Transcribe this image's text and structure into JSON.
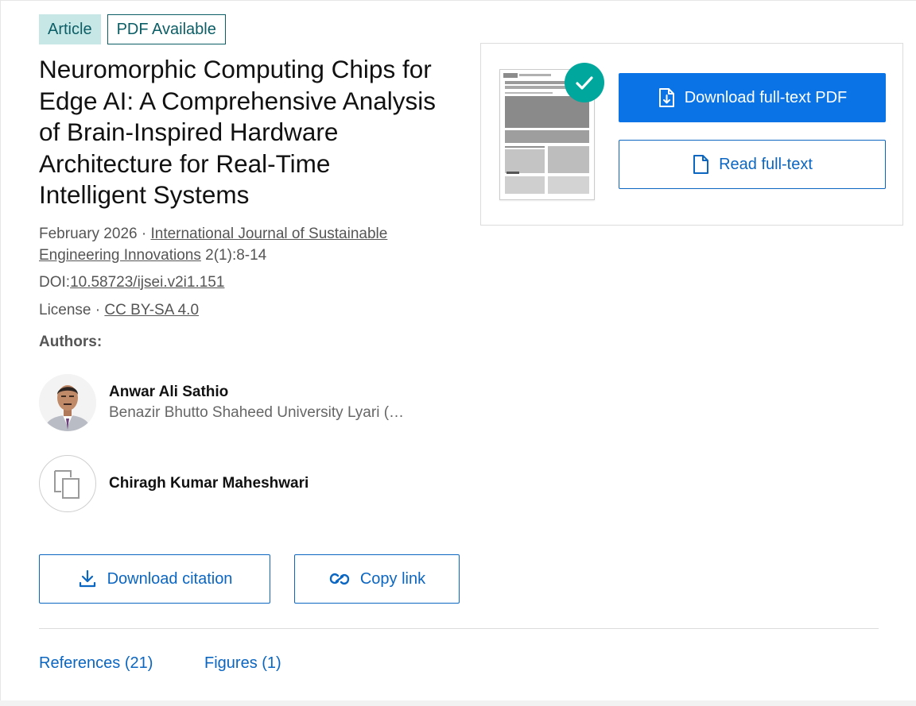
{
  "badges": {
    "type": "Article",
    "pdf": "PDF Available"
  },
  "title": "Neuromorphic Computing Chips for Edge AI: A Comprehensive Analysis of Brain-Inspired Hardware Architecture for Real-Time Intelligent Systems",
  "meta": {
    "date": "February 2026",
    "separator": " · ",
    "journal": "International Journal of Sustainable Engineering Innovations",
    "issue": " 2(1):8-14",
    "doi_label": "DOI:",
    "doi": "10.58723/ijsei.v2i1.151",
    "license_label": "License",
    "license": "CC BY-SA 4.0"
  },
  "authors_label": "Authors:",
  "authors": [
    {
      "name": "Anwar Ali Sathio",
      "affiliation": "Benazir Bhutto Shaheed University Lyari (…"
    },
    {
      "name": "Chiragh Kumar Maheshwari",
      "affiliation": ""
    }
  ],
  "actions": {
    "download_citation": "Download citation",
    "copy_link": "Copy link",
    "download_pdf": "Download full-text PDF",
    "read_fulltext": "Read full-text"
  },
  "tabs": [
    {
      "label": "References (21)"
    },
    {
      "label": "Figures (1)"
    }
  ],
  "colors": {
    "accent": "#0a74e6",
    "link": "#0b66c2",
    "badge_bg": "#c7e7e6",
    "badge_text": "#0b5e66",
    "check": "#00a79d"
  },
  "icons": [
    "download-icon",
    "link-icon",
    "file-download-icon",
    "file-icon",
    "checkmark-icon",
    "placeholder-avatar-icon"
  ]
}
